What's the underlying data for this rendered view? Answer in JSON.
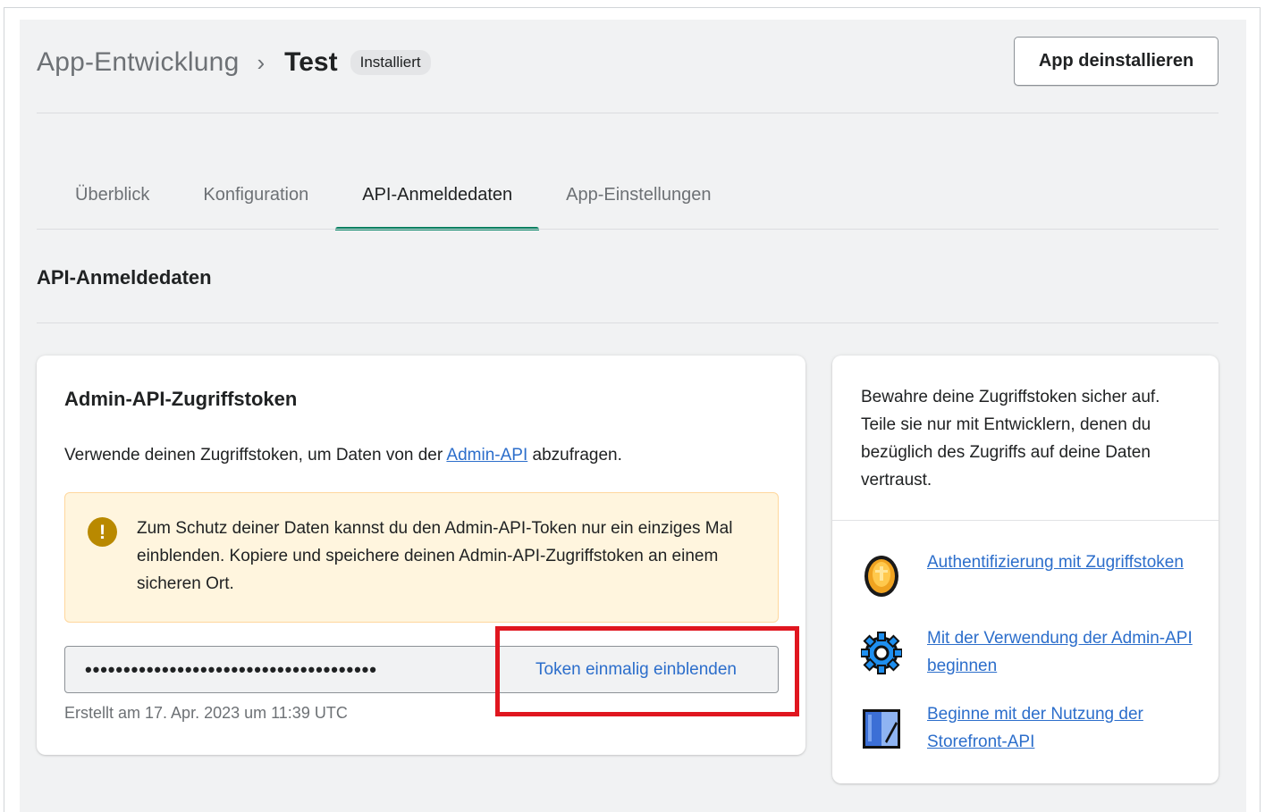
{
  "breadcrumb": {
    "parent": "App-Entwicklung",
    "current": "Test",
    "badge": "Installiert"
  },
  "header": {
    "uninstall_label": "App deinstallieren"
  },
  "tabs": [
    {
      "label": "Überblick",
      "active": false
    },
    {
      "label": "Konfiguration",
      "active": false
    },
    {
      "label": "API-Anmeldedaten",
      "active": true
    },
    {
      "label": "App-Einstellungen",
      "active": false
    }
  ],
  "section": {
    "title": "API-Anmeldedaten"
  },
  "token_card": {
    "title": "Admin-API-Zugriffstoken",
    "desc_before": "Verwende deinen Zugriffstoken, um Daten von der ",
    "desc_link": "Admin-API",
    "desc_after": " abzufragen.",
    "banner_icon": "!",
    "banner_text": "Zum Schutz deiner Daten kannst du den Admin-API-Token nur ein einziges Mal einblenden. Kopiere und speichere deinen Admin-API-Zugriffstoken an einem sicheren Ort.",
    "token_mask": "••••••••••••••••••••••••••••••••••••••",
    "reveal_label": "Token einmalig einblenden",
    "created": "Erstellt am 17. Apr. 2023 um 11:39 UTC"
  },
  "side_card": {
    "text": "Bewahre deine Zugriffstoken sicher auf. Teile sie nur mit Entwicklern, denen du bezüglich des Zugriffs auf deine Daten vertraust.",
    "resources": [
      {
        "label": "Authentifizierung mit Zugriffstoken",
        "icon": "coin-icon"
      },
      {
        "label": "Mit der Verwendung der Admin-API beginnen",
        "icon": "gear-icon"
      },
      {
        "label": "Beginne mit der Nutzung der Storefront-API",
        "icon": "storefront-icon"
      }
    ]
  },
  "colors": {
    "accent": "#008060",
    "link": "#2c6ecb",
    "warning_bg": "#fff5de",
    "warning_icon": "#b98900",
    "highlight": "#e0161f"
  }
}
